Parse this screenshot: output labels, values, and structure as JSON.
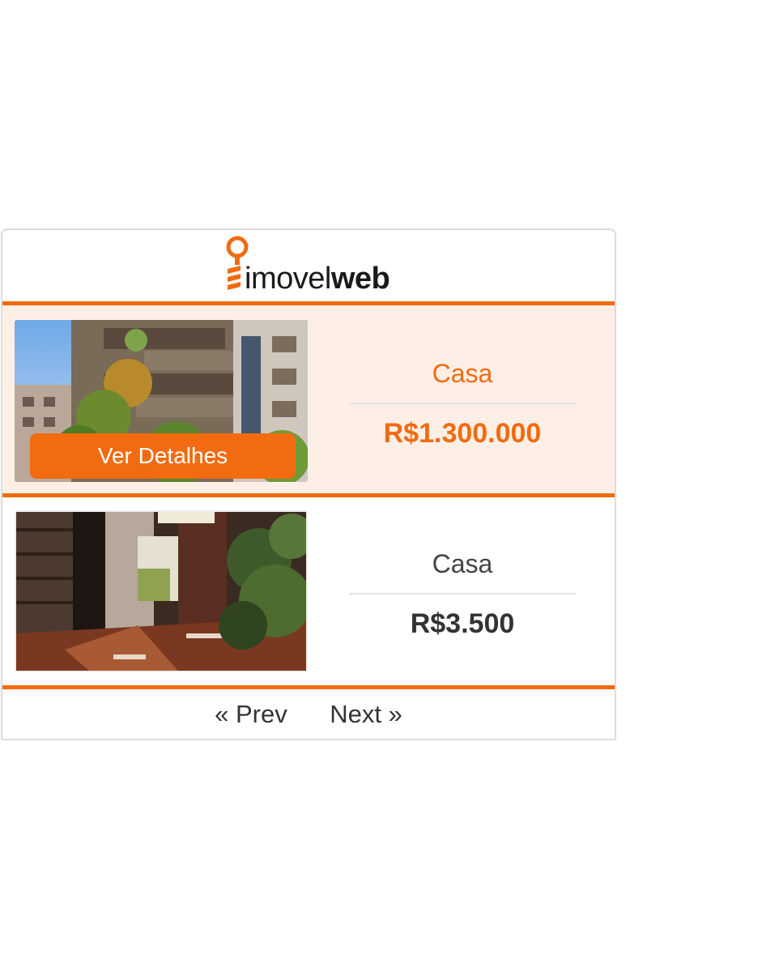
{
  "brand": {
    "name_light": "imovel",
    "name_bold": "web",
    "accent_color": "#f26b10"
  },
  "listings": [
    {
      "type": "Casa",
      "price": "R$1.300.000",
      "button_label": "Ver Detalhes",
      "highlighted": true
    },
    {
      "type": "Casa",
      "price": "R$3.500",
      "highlighted": false
    }
  ],
  "pagination": {
    "prev_label": "« Prev",
    "next_label": "Next »"
  }
}
